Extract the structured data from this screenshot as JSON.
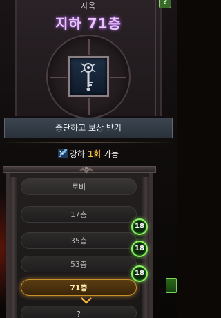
{
  "header": {
    "subtitle": "지옥",
    "title": "지하 71층",
    "help_label": "?"
  },
  "emblem": {
    "icon": "key-scepter-icon"
  },
  "actions": {
    "stop_and_claim_label": "중단하고 보상 받기"
  },
  "enhance": {
    "prefix": "강하",
    "count": "1회",
    "suffix": "가능",
    "icon": "enhance-stairs-icon"
  },
  "floors": {
    "lobby": "로비",
    "f17": "17층",
    "f35": "35층",
    "f53": "53층",
    "current": "71층",
    "next": "?"
  },
  "badges": [
    "18",
    "18",
    "18"
  ],
  "colors": {
    "title_glow": "#c878ff",
    "current_floor": "#c9902a",
    "badge_green": "#8ff36a",
    "highlight_count": "#f0c040"
  }
}
